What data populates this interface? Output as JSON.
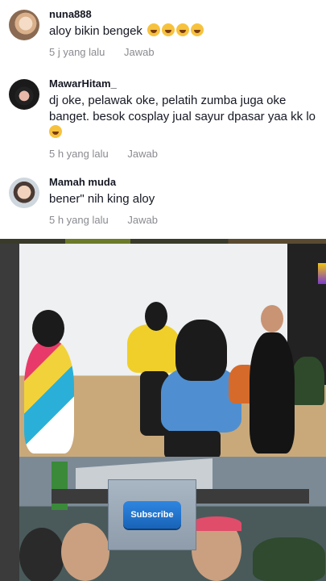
{
  "comments": [
    {
      "author": "nuna888",
      "text": "aloy bikin bengek",
      "emoji_count": 4,
      "time": "5 j yang lalu",
      "reply_label": "Jawab"
    },
    {
      "author": "MawarHitam_",
      "text": "dj oke, pelawak oke, pelatih zumba juga oke banget. besok cosplay jual sayur dpasar yaa kk lo",
      "emoji_count": 1,
      "time": "5 h yang lalu",
      "reply_label": "Jawab"
    },
    {
      "author": "Mamah muda",
      "text": "bener\" nih king aloy",
      "emoji_count": 0,
      "time": "5 h yang lalu",
      "reply_label": "Jawab"
    }
  ],
  "video": {
    "subscribe_label": "Subscribe"
  },
  "colors": {
    "text_primary": "#161823",
    "text_secondary": "#8a8b91",
    "subscribe_blue": "#1f74cf"
  }
}
